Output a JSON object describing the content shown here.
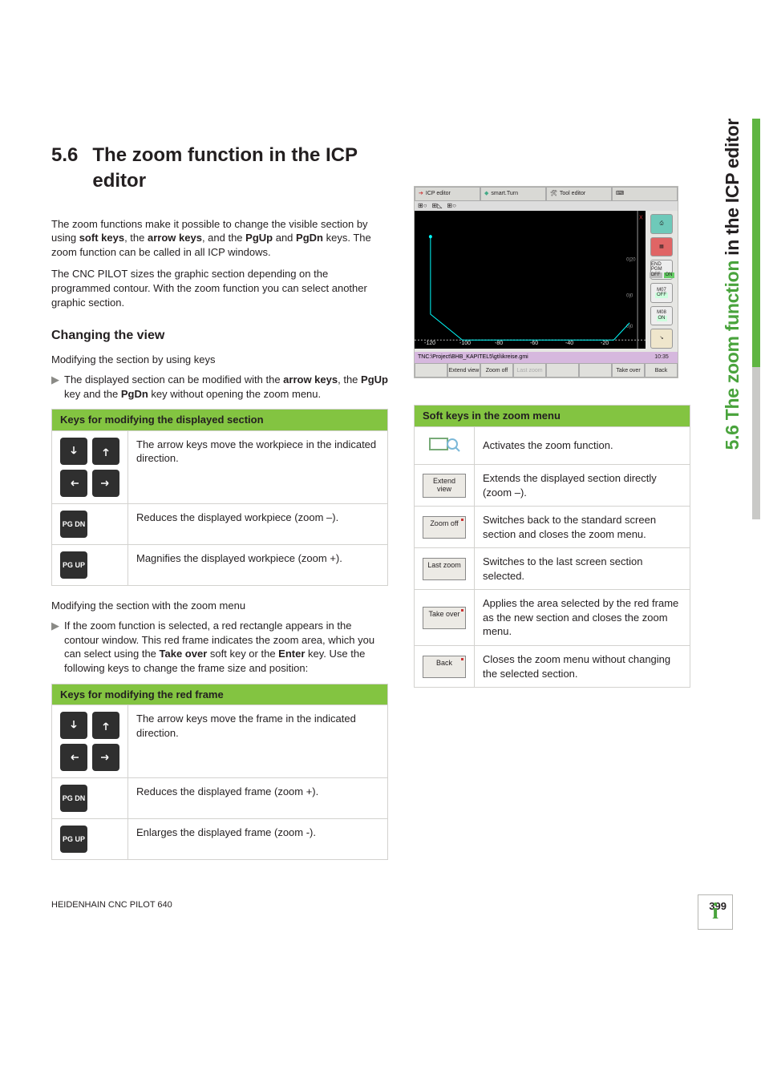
{
  "sidetab_prefix": "5.6 The zoom function",
  "sidetab_suffix": " in the ICP editor",
  "heading_num": "5.6",
  "heading_txt": "The zoom function in the ICP editor",
  "intro_1a": "The zoom functions make it possible to change the visible section by using ",
  "intro_1_soft": "soft keys",
  "intro_1b": ", the ",
  "intro_1_arrow": "arrow keys",
  "intro_1c": ", and the ",
  "intro_1_pgup": "PgUp",
  "intro_1d": " and ",
  "intro_1_pgdn": "PgDn",
  "intro_1e": " keys. The zoom function can be called in all ICP windows.",
  "intro_2": "The CNC PILOT sizes the graphic section depending on the programmed contour. With the zoom function you can select another graphic section.",
  "h2": "Changing the view",
  "mod_by_keys": "Modifying the section by using keys",
  "bullet1_a": "The displayed section can be modified with the ",
  "bullet1_arrow": "arrow keys",
  "bullet1_b": ", the ",
  "bullet1_pgup": "PgUp",
  "bullet1_c": " key and the ",
  "bullet1_pgdn": "PgDn",
  "bullet1_d": " key without opening the zoom menu.",
  "tblA_head": "Keys for modifying the displayed section",
  "tblA_r1": "The arrow keys move the workpiece in the indicated direction.",
  "tblA_r2": "Reduces the displayed workpiece (zoom –).",
  "tblA_r3": "Magnifies the displayed workpiece (zoom +).",
  "mod_by_menu": "Modifying the section with the zoom menu",
  "bullet2_a": "If the zoom function is selected, a red rectangle appears in the contour window. This red frame indicates the zoom area, which you can select using the ",
  "bullet2_take": "Take over",
  "bullet2_b": " soft key or the ",
  "bullet2_enter": "Enter",
  "bullet2_c": " key. Use the following keys to change the frame size and position:",
  "tblB_head": "Keys for modifying the red frame",
  "tblB_r1": "The arrow keys move the frame in the indicated direction.",
  "tblB_r2": "Reduces the displayed frame (zoom +).",
  "tblB_r3": "Enlarges the displayed frame (zoom -).",
  "pgdn_label": "PG DN",
  "pgup_label": "PG UP",
  "shot": {
    "tab1": "ICP editor",
    "tab2": "smart.Turn",
    "tab3": "Tool editor",
    "path": "TNC:\\Project\\BHB_KAPITEL5\\gti\\ikreise.gmi",
    "time": "10:35",
    "sk1": "Extend view",
    "sk2": "Zoom off",
    "sk3": "Last zoom",
    "sk4": "Take over",
    "sk5": "Back",
    "side_end": "END PGM",
    "side_off": "OFF",
    "side_on": "ON",
    "side_m07": "M07",
    "side_m08": "M08",
    "xt": [
      "-120",
      "-100",
      "-80",
      "-60",
      "-40",
      "-20"
    ]
  },
  "soft_head": "Soft keys in the zoom menu",
  "soft_r1": "Activates the zoom function.",
  "soft_r2_btn": "Extend view",
  "soft_r2": "Extends the displayed section directly (zoom –).",
  "soft_r3_btn": "Zoom off",
  "soft_r3": "Switches back to the standard screen section and closes the zoom menu.",
  "soft_r4_btn": "Last zoom",
  "soft_r4": "Switches to the last screen section selected.",
  "soft_r5_btn": "Take over",
  "soft_r5": "Applies the area selected by the red frame as the new section and closes the zoom menu.",
  "soft_r6_btn": "Back",
  "soft_r6": "Closes the zoom menu without changing the selected section.",
  "footer_left": "HEIDENHAIN CNC PILOT 640",
  "footer_page": "399"
}
